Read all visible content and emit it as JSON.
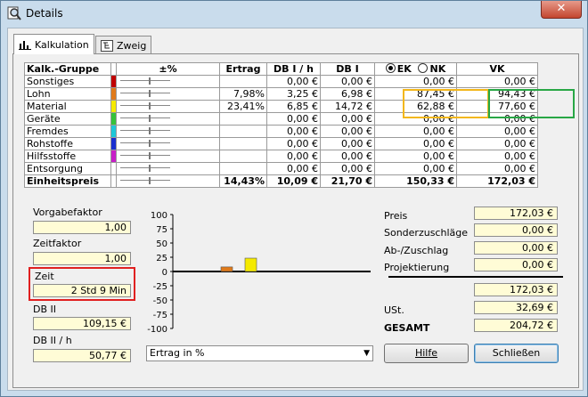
{
  "window": {
    "title": "Details",
    "close_label": "✕"
  },
  "tabs": [
    {
      "label": "Kalkulation"
    },
    {
      "label": "Zweig"
    }
  ],
  "grid": {
    "headers": {
      "group": "Kalk.-Gruppe",
      "pm": "±%",
      "ertrag": "Ertrag",
      "db1h": "DB I / h",
      "db1": "DB I",
      "ek": "EK",
      "nk": "NK",
      "vk": "VK"
    },
    "rows": [
      {
        "name": "Sonstiges",
        "color": "#c00000",
        "ertrag": "",
        "db1h": "0,00 €",
        "db1": "0,00 €",
        "ek": "0,00 €",
        "vk": "0,00 €"
      },
      {
        "name": "Lohn",
        "color": "#e07a1a",
        "ertrag": "7,98%",
        "db1h": "3,25 €",
        "db1": "6,98 €",
        "ek": "87,45 €",
        "vk": "94,43 €"
      },
      {
        "name": "Material",
        "color": "#f5ea00",
        "ertrag": "23,41%",
        "db1h": "6,85 €",
        "db1": "14,72 €",
        "ek": "62,88 €",
        "vk": "77,60 €"
      },
      {
        "name": "Geräte",
        "color": "#36c23a",
        "ertrag": "",
        "db1h": "0,00 €",
        "db1": "0,00 €",
        "ek": "0,00 €",
        "vk": "0,00 €"
      },
      {
        "name": "Fremdes",
        "color": "#1ec8d8",
        "ertrag": "",
        "db1h": "0,00 €",
        "db1": "0,00 €",
        "ek": "0,00 €",
        "vk": "0,00 €"
      },
      {
        "name": "Rohstoffe",
        "color": "#1a2fd0",
        "ertrag": "",
        "db1h": "0,00 €",
        "db1": "0,00 €",
        "ek": "0,00 €",
        "vk": "0,00 €"
      },
      {
        "name": "Hilfsstoffe",
        "color": "#c81ec8",
        "ertrag": "",
        "db1h": "0,00 €",
        "db1": "0,00 €",
        "ek": "0,00 €",
        "vk": "0,00 €"
      },
      {
        "name": "Entsorgung",
        "color": "#ffffff",
        "ertrag": "",
        "db1h": "0,00 €",
        "db1": "0,00 €",
        "ek": "0,00 €",
        "vk": "0,00 €"
      }
    ],
    "total": {
      "name": "Einheitspreis",
      "ertrag": "14,43%",
      "db1h": "10,09 €",
      "db1": "21,70 €",
      "ek": "150,33 €",
      "vk": "172,03 €"
    }
  },
  "left": {
    "vorgabefaktor_label": "Vorgabefaktor",
    "vorgabefaktor": "1,00",
    "zeitfaktor_label": "Zeitfaktor",
    "zeitfaktor": "1,00",
    "zeit_label": "Zeit",
    "zeit": "2 Std 9 Min",
    "db2_label": "DB II",
    "db2": "109,15 €",
    "db2h_label": "DB II / h",
    "db2h": "50,77 €"
  },
  "chart_data": {
    "type": "bar",
    "categories": [
      "Lohn",
      "Material"
    ],
    "values": [
      7.98,
      23.41
    ],
    "colors": [
      "#e07a1a",
      "#f5ea00"
    ],
    "ylim": [
      -100,
      100
    ],
    "yticks": [
      "100",
      "75",
      "50",
      "25",
      "0",
      "-25",
      "-50",
      "-75",
      "-100"
    ],
    "title": "",
    "xlabel": "",
    "ylabel": ""
  },
  "chart_select": "Ertrag in %",
  "right": {
    "preis_label": "Preis",
    "preis": "172,03 €",
    "sonder_label": "Sonderzuschläge",
    "sonder": "0,00 €",
    "ab_label": "Ab-/Zuschlag",
    "ab": "0,00 €",
    "proj_label": "Projektierung",
    "proj": "0,00 €",
    "sum": "172,03 €",
    "ust_label": "USt.",
    "ust": "32,69 €",
    "gesamt_label": "GESAMT",
    "gesamt": "204,72 €"
  },
  "buttons": {
    "hilfe": "Hilfe",
    "schliessen": "Schließen"
  }
}
